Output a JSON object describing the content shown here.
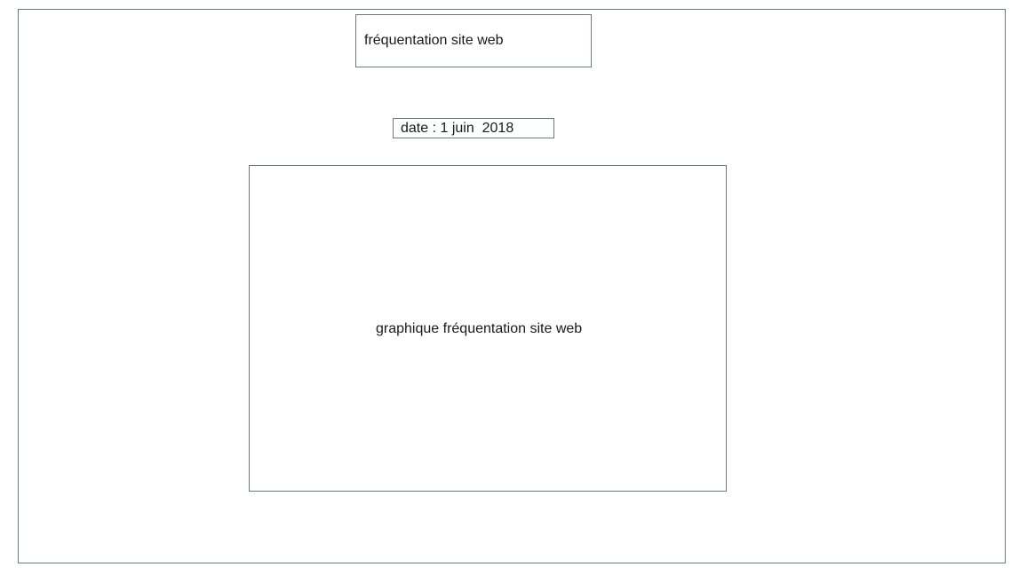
{
  "title": "fréquentation site web",
  "date_label": "date : 1 juin  2018",
  "chart_placeholder": "graphique fréquentation site web",
  "colors": {
    "border": "#6f7780",
    "background": "#ffffff",
    "text": "#1a1a1a"
  }
}
